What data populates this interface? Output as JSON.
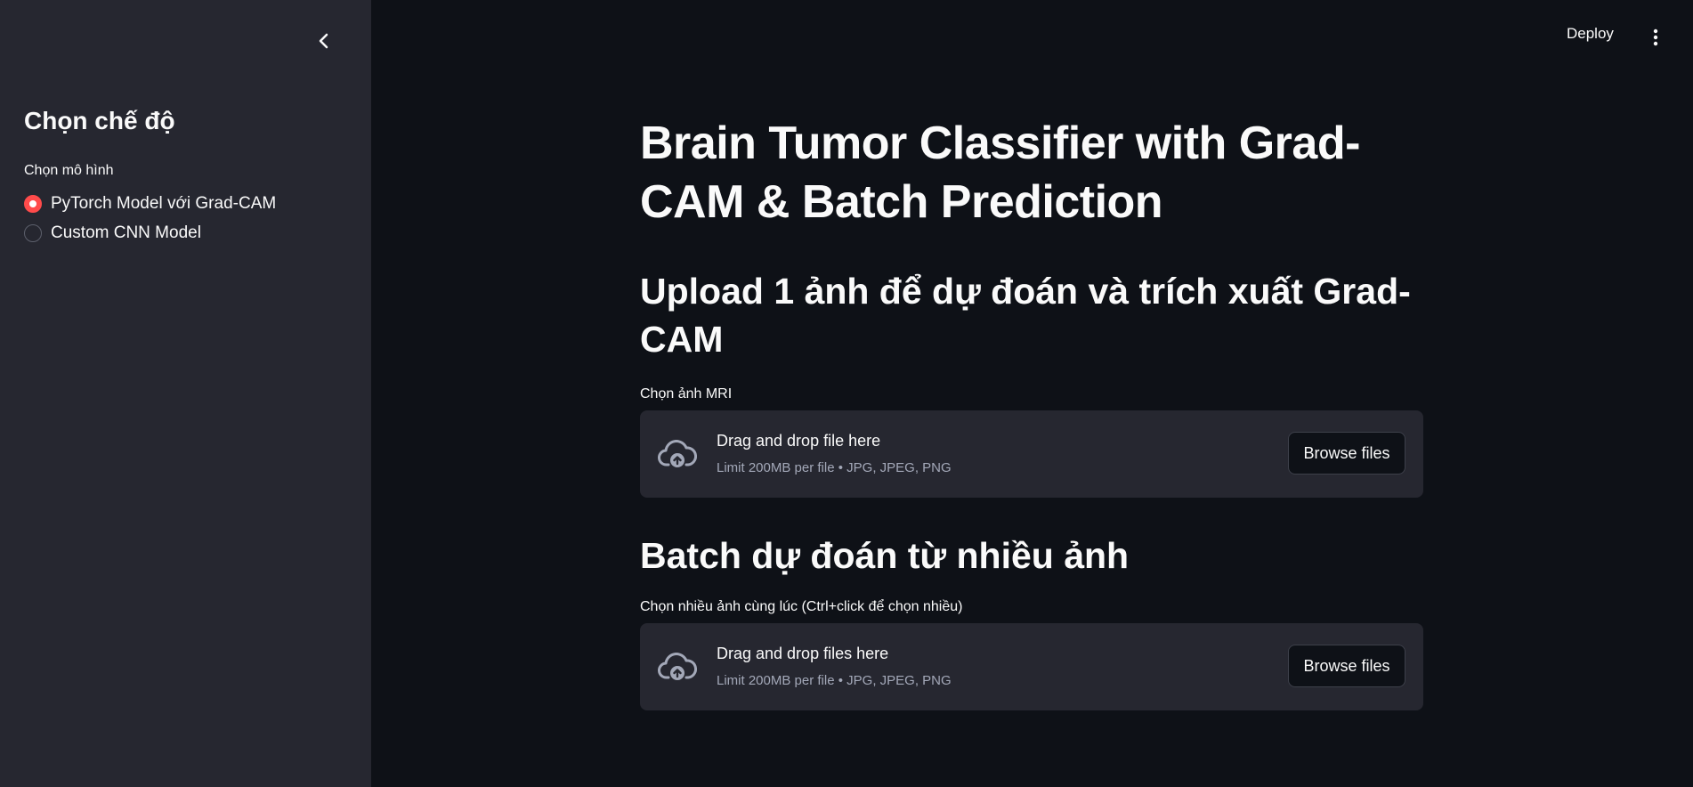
{
  "colors": {
    "sidebar_bg": "#262730",
    "main_bg": "#0e1117",
    "accent": "#ff4b4b",
    "muted_text": "#a3a8b8"
  },
  "header": {
    "deploy_label": "Deploy",
    "menu_icon": "vertical-dots-icon"
  },
  "sidebar": {
    "collapse_icon": "chevron-left-icon",
    "title": "Chọn chế độ",
    "radio_label": "Chọn mô hình",
    "options": [
      {
        "label": "PyTorch Model với Grad-CAM",
        "selected": true
      },
      {
        "label": "Custom CNN Model",
        "selected": false
      }
    ]
  },
  "main": {
    "title": "Brain Tumor Classifier with Grad-CAM & Batch Prediction",
    "single_upload": {
      "heading": "Upload 1 ảnh để dự đoán và trích xuất Grad-CAM",
      "field_label": "Chọn ảnh MRI",
      "dropzone_title": "Drag and drop file here",
      "dropzone_sub": "Limit 200MB per file • JPG, JPEG, PNG",
      "button_label": "Browse files",
      "icon": "cloud-upload-icon"
    },
    "batch_upload": {
      "heading": "Batch dự đoán từ nhiều ảnh",
      "field_label": "Chọn nhiều ảnh cùng lúc (Ctrl+click để chọn nhiều)",
      "dropzone_title": "Drag and drop files here",
      "dropzone_sub": "Limit 200MB per file • JPG, JPEG, PNG",
      "button_label": "Browse files",
      "icon": "cloud-upload-icon"
    }
  }
}
